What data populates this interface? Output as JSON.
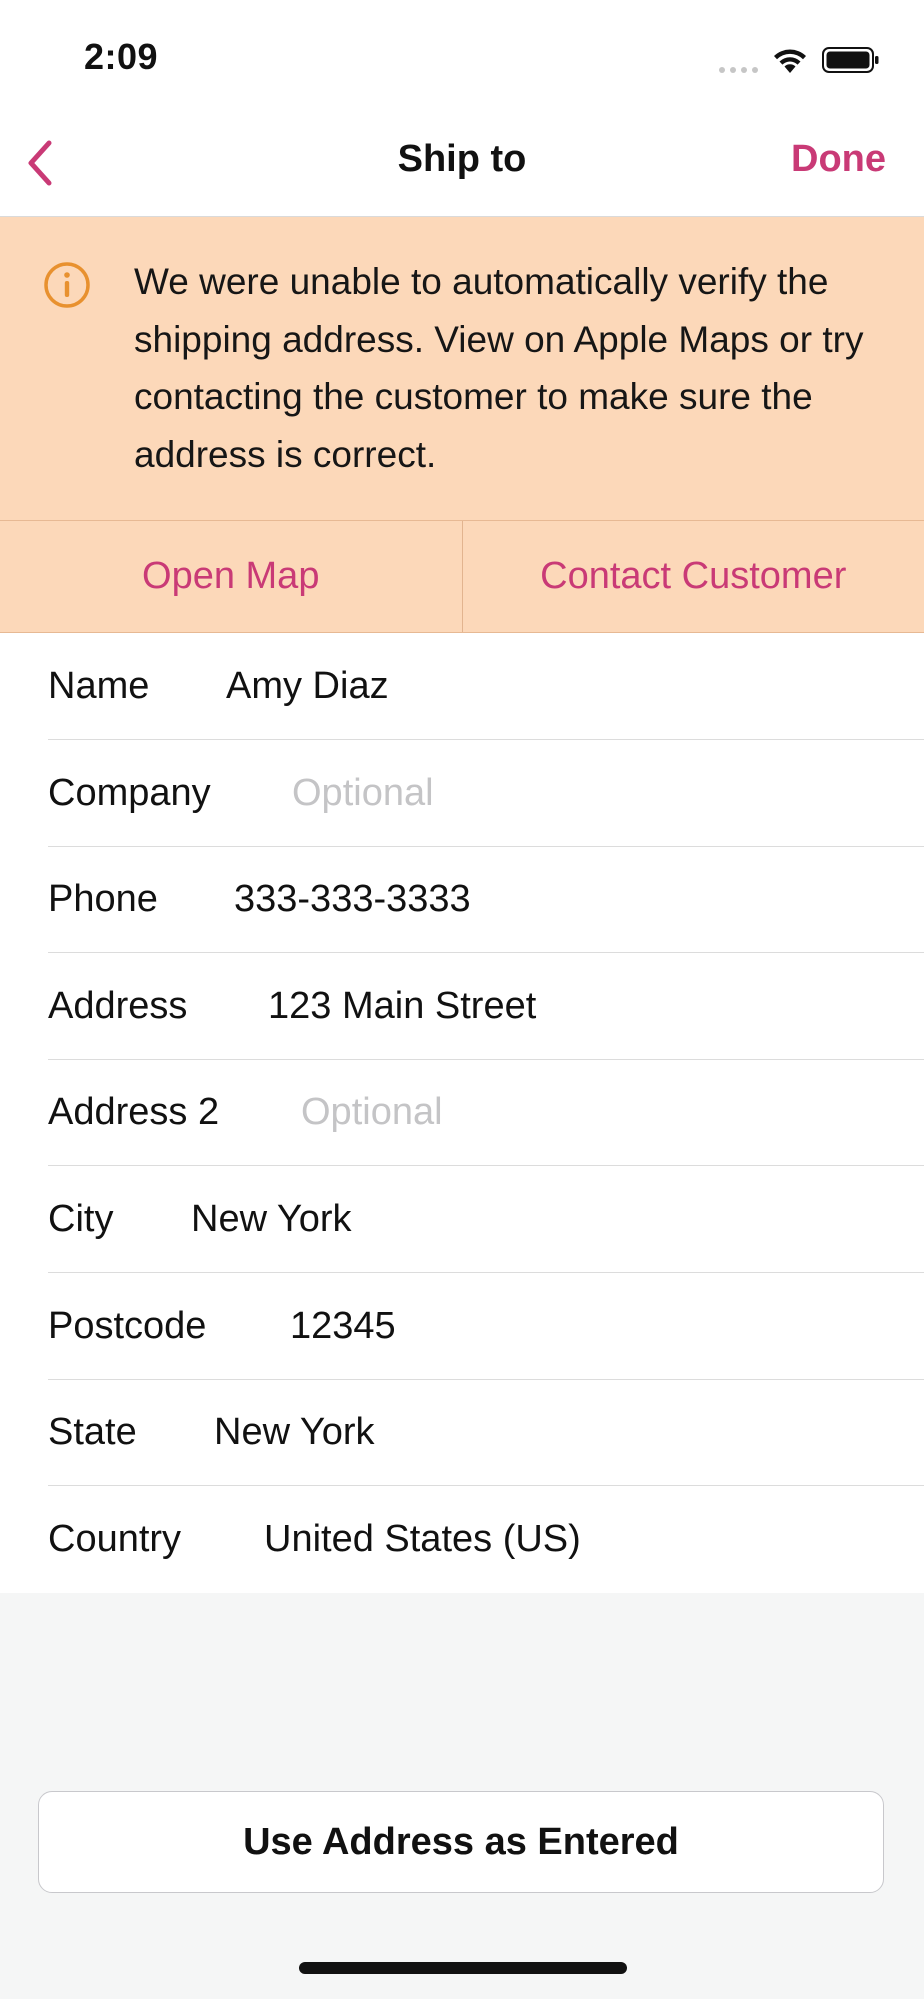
{
  "status_bar": {
    "time": "2:09",
    "icons": [
      "cellular-signal-icon",
      "wifi-icon",
      "battery-icon"
    ]
  },
  "nav": {
    "title": "Ship to",
    "done_label": "Done",
    "back_icon": "chevron-left-icon"
  },
  "notice": {
    "icon": "info-circle-icon",
    "message": "We were unable to automatically verify the shipping address. View on Apple Maps or try contacting the customer to make sure the address is correct."
  },
  "actions": {
    "open_map": "Open Map",
    "contact_customer": "Contact Customer"
  },
  "form": {
    "fields": [
      {
        "label": "Name",
        "value": "Amy Diaz",
        "placeholder": ""
      },
      {
        "label": "Company",
        "value": "",
        "placeholder": "Optional"
      },
      {
        "label": "Phone",
        "value": "333-333-3333",
        "placeholder": ""
      },
      {
        "label": "Address",
        "value": "123 Main Street",
        "placeholder": ""
      },
      {
        "label": "Address 2",
        "value": "",
        "placeholder": "Optional"
      },
      {
        "label": "City",
        "value": "New York",
        "placeholder": ""
      },
      {
        "label": "Postcode",
        "value": "12345",
        "placeholder": ""
      },
      {
        "label": "State",
        "value": "New York",
        "placeholder": ""
      },
      {
        "label": "Country",
        "value": "United States (US)",
        "placeholder": ""
      }
    ]
  },
  "footer": {
    "use_address_label": "Use Address as Entered"
  },
  "colors": {
    "accent": "#c93a76",
    "notice_background": "#fcd8b9",
    "info_icon": "#e8912f",
    "page_background": "#f5f6f6"
  }
}
